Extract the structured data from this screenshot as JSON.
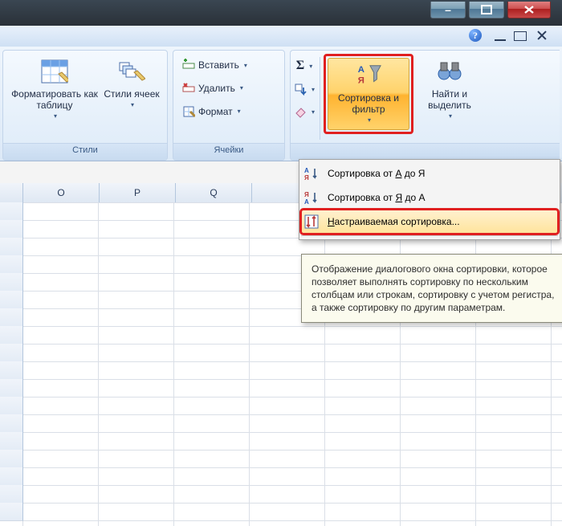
{
  "window": {
    "min_label": "–",
    "max_label": "□",
    "close_label": "x"
  },
  "ribbon": {
    "groups": {
      "styles": {
        "label": "Стили",
        "format_table": "Форматировать как таблицу",
        "cell_styles": "Стили ячеек"
      },
      "cells": {
        "label": "Ячейки",
        "insert": "Вставить",
        "delete": "Удалить",
        "format": "Формат"
      },
      "editing": {
        "sort_filter": "Сортировка и фильтр",
        "find_select": "Найти и выделить",
        "autosum": "Σ"
      }
    }
  },
  "menu": {
    "sort_az": "Сортировка от А до Я",
    "sort_za": "Сортировка от Я до А",
    "custom_sort": "Настраиваемая сортировка...",
    "accel_az": "А",
    "accel_za": "Я",
    "accel_custom": "Н"
  },
  "tooltip": {
    "text": "Отображение диалогового окна сортировки, которое позволяет выполнять сортировку по нескольким столбцам или строкам, сортировку с учетом регистра, а также сортировку по другим параметрам."
  },
  "columns": [
    "O",
    "P",
    "Q"
  ]
}
